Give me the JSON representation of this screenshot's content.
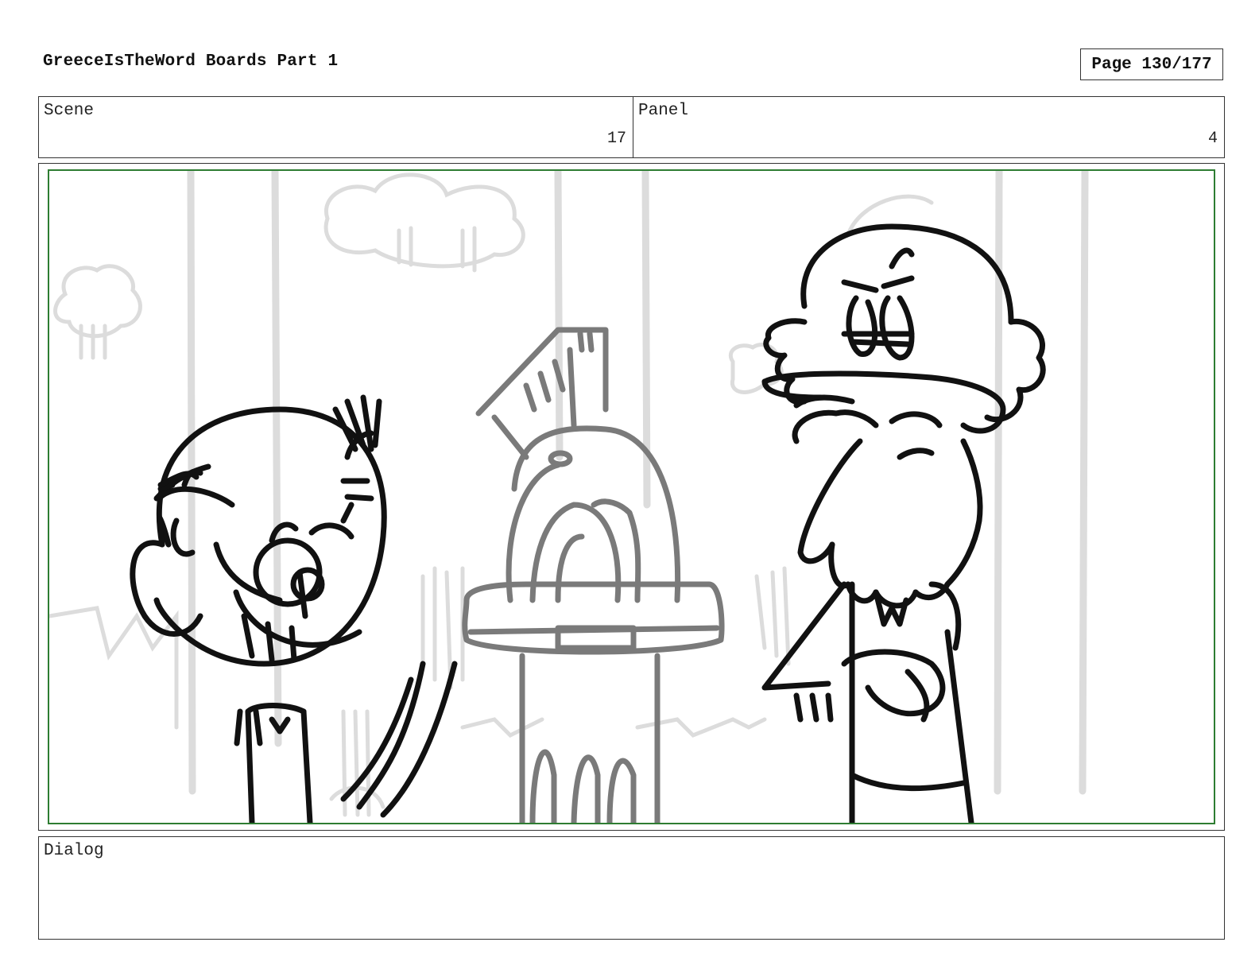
{
  "header": {
    "title": "GreeceIsTheWord Boards Part 1",
    "page": "Page 130/177"
  },
  "info": {
    "scene_label": "Scene",
    "scene_value": "17",
    "panel_label": "Panel",
    "panel_value": "4"
  },
  "dialog": {
    "label": "Dialog",
    "text": ""
  },
  "colors": {
    "frame_border": "#2e7d32",
    "sketch_line": "#111111",
    "background_line": "#dcdcdc",
    "prop_line": "#7a7a7a"
  }
}
